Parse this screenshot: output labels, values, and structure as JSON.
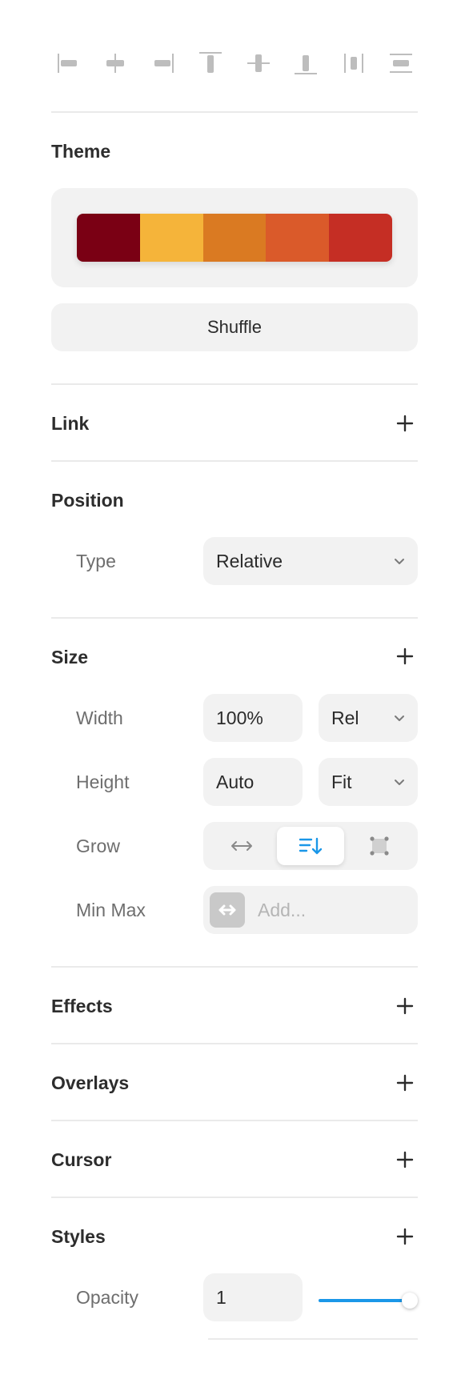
{
  "alignment": {
    "icons": [
      "align-left-icon",
      "align-center-horizontal-icon",
      "align-right-icon",
      "align-top-icon",
      "align-center-vertical-icon",
      "align-bottom-icon",
      "distribute-horizontal-icon",
      "distribute-vertical-icon"
    ]
  },
  "theme": {
    "title": "Theme",
    "palette": [
      "#7a0014",
      "#f5b43a",
      "#da7a22",
      "#da5a2a",
      "#c52e24"
    ],
    "shuffle_label": "Shuffle"
  },
  "link": {
    "title": "Link"
  },
  "position": {
    "title": "Position",
    "type_label": "Type",
    "type_value": "Relative"
  },
  "size": {
    "title": "Size",
    "width_label": "Width",
    "width_value": "100%",
    "width_unit": "Rel",
    "height_label": "Height",
    "height_value": "Auto",
    "height_unit": "Fit",
    "grow_label": "Grow",
    "grow_options": [
      "grow-horizontal-icon",
      "grow-vertical-icon",
      "grow-free-icon"
    ],
    "grow_selected": 1,
    "minmax_label": "Min Max",
    "minmax_placeholder": "Add..."
  },
  "effects": {
    "title": "Effects"
  },
  "overlays": {
    "title": "Overlays"
  },
  "cursor": {
    "title": "Cursor"
  },
  "styles": {
    "title": "Styles",
    "opacity_label": "Opacity",
    "opacity_value": "1",
    "opacity_fraction": 1
  },
  "colors": {
    "accent": "#1a97e8",
    "field_bg": "#f2f2f2",
    "divider": "#eaeaea"
  }
}
